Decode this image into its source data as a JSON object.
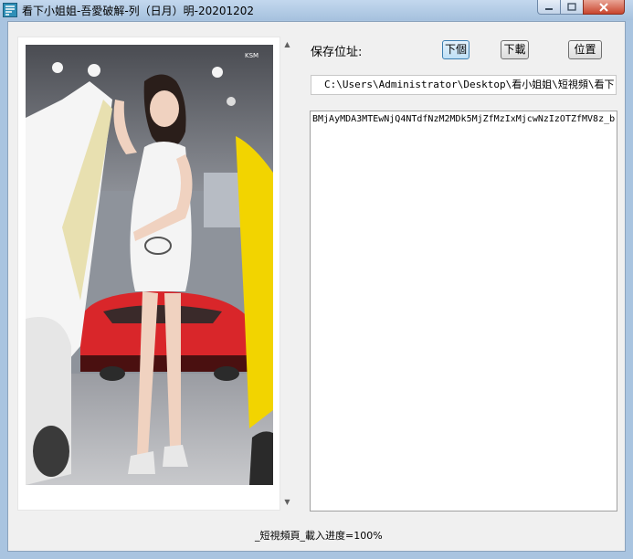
{
  "window": {
    "title": "看下小姐姐-吾愛破解-列（日月）明-20201202"
  },
  "controls": {
    "save_label": "保存位址:",
    "next_button": "下個",
    "download_button": "下載",
    "location_button": "位置"
  },
  "path": {
    "value": "C:\\Users\\Administrator\\Desktop\\看小姐姐\\短視頻\\看下"
  },
  "log": {
    "line": "BMjAyMDA3MTEwNjQ4NTdfNzM2MDk5MjZfMzIxMjcwNzIzOTZfMV8z_b"
  },
  "status": {
    "text": "_短視頻頁_載入进度=100%"
  },
  "photo": {
    "watermark": "KSM\n大全"
  },
  "colors": {
    "titlebar": "#a6c1de",
    "client_bg": "#f0f0f0",
    "close_button": "#c9452d",
    "photo_car_red": "#d9262a",
    "photo_door_yellow": "#f2d400"
  }
}
